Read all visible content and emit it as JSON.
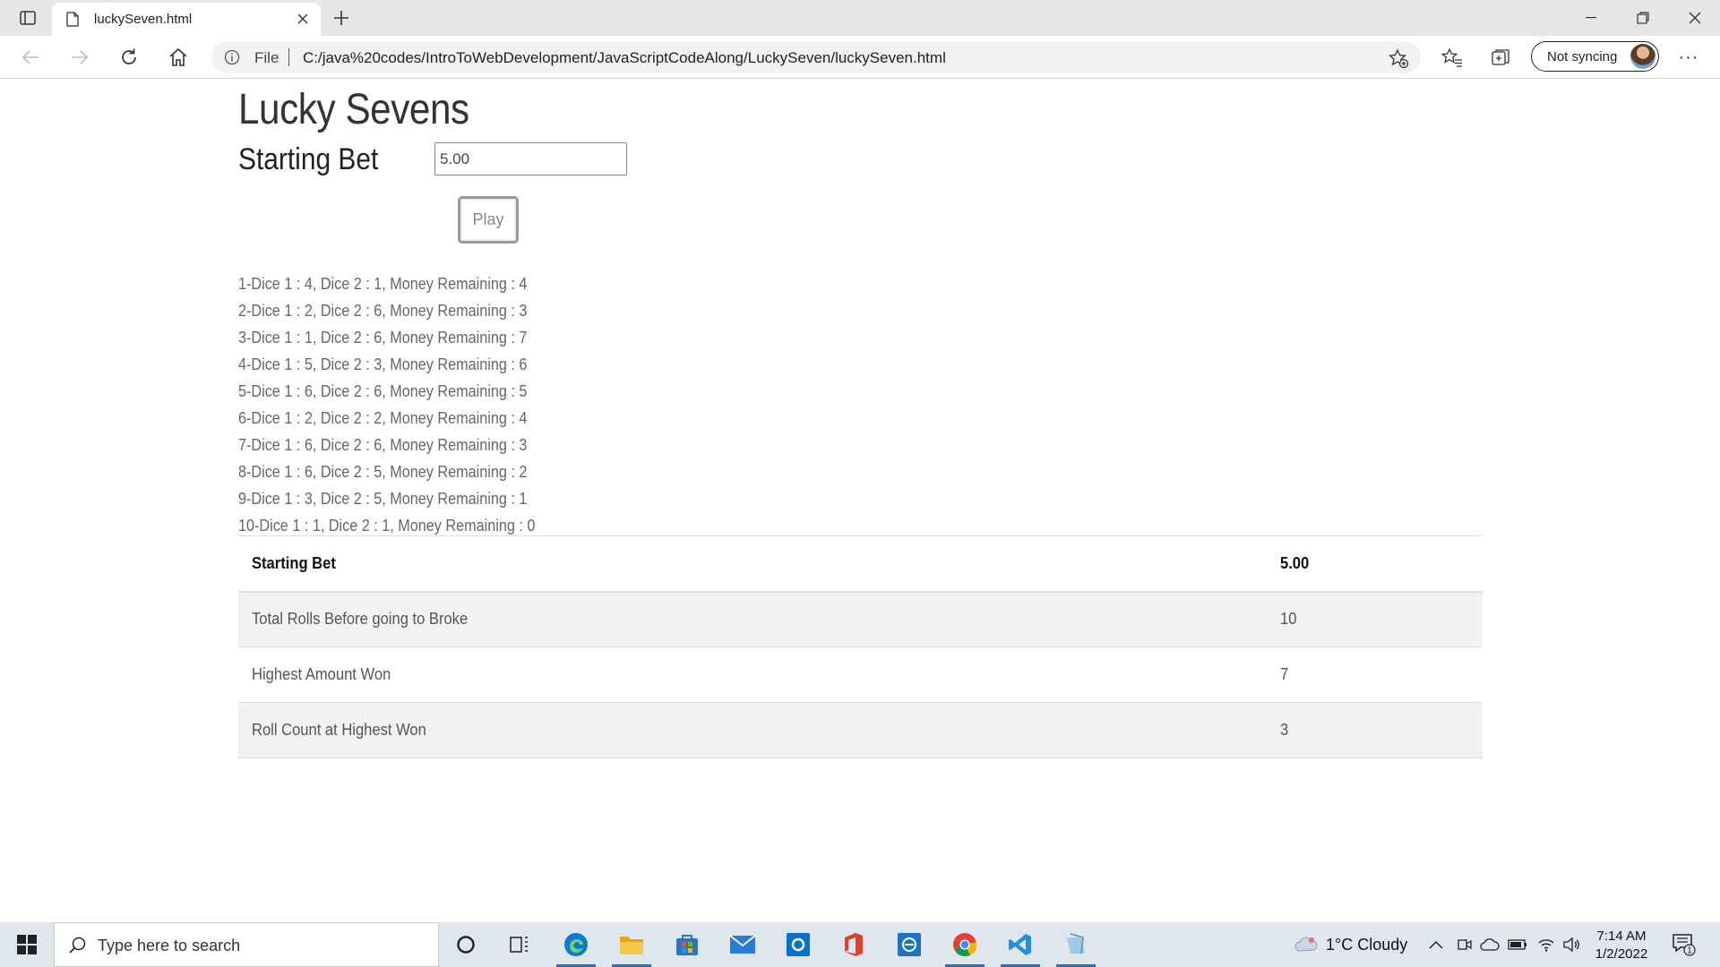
{
  "browser": {
    "tab_title": "luckySeven.html",
    "address_scheme_label": "File",
    "url": "C:/java%20codes/IntroToWebDevelopment/JavaScriptCodeAlong/LuckySeven/luckySeven.html",
    "sync_label": "Not syncing"
  },
  "page": {
    "title": "Lucky Sevens",
    "bet_label": "Starting Bet",
    "bet_value": "5.00",
    "play_label": "Play",
    "rolls": [
      "1-Dice 1 : 4, Dice 2 : 1, Money Remaining : 4",
      "2-Dice 1 : 2, Dice 2 : 6, Money Remaining : 3",
      "3-Dice 1 : 1, Dice 2 : 6, Money Remaining : 7",
      "4-Dice 1 : 5, Dice 2 : 3, Money Remaining : 6",
      "5-Dice 1 : 6, Dice 2 : 6, Money Remaining : 5",
      "6-Dice 1 : 2, Dice 2 : 2, Money Remaining : 4",
      "7-Dice 1 : 6, Dice 2 : 6, Money Remaining : 3",
      "8-Dice 1 : 6, Dice 2 : 5, Money Remaining : 2",
      "9-Dice 1 : 3, Dice 2 : 5, Money Remaining : 1",
      "10-Dice 1 : 1, Dice 2 : 1, Money Remaining : 0"
    ],
    "results": [
      {
        "label": "Starting Bet",
        "value": "5.00"
      },
      {
        "label": "Total Rolls Before going to Broke",
        "value": "10"
      },
      {
        "label": "Highest Amount Won",
        "value": "7"
      },
      {
        "label": "Roll Count at Highest Won",
        "value": "3"
      }
    ]
  },
  "taskbar": {
    "search_placeholder": "Type here to search",
    "weather": "1°C  Cloudy",
    "time": "7:14 AM",
    "date": "1/2/2022",
    "notification_count": "1",
    "apps": [
      "task-view",
      "widgets",
      "edge",
      "file-explorer",
      "microsoft-store",
      "mail",
      "outlook",
      "office",
      "remote-app",
      "chrome",
      "vscode",
      "notepad"
    ]
  },
  "colors": {
    "tabbar_bg": "#e6e6e6",
    "taskbar_bg": "#dfe6ee",
    "table_stripe": "#f2f2f2",
    "edge_blue": "#0c7bd6",
    "vscode_blue": "#2b8fd6"
  }
}
